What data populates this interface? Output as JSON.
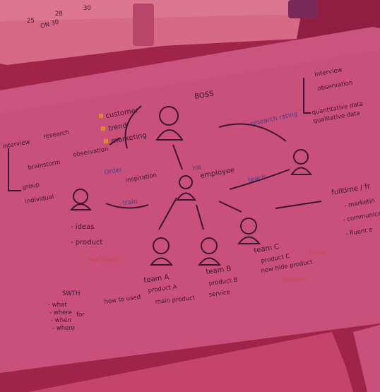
{
  "photo": {
    "tint": "#c43a64",
    "calendar_numbers": [
      "25",
      "28",
      "30"
    ],
    "calendar_note": "ON 30"
  },
  "sketch": {
    "boss": {
      "label": "BOSS",
      "checklist": [
        "customer",
        "trend",
        "marketing"
      ]
    },
    "research_flow": {
      "note": "research rating",
      "steps": [
        "interview",
        "observation",
        "quantitative data",
        "qualitative data"
      ]
    },
    "left_group": {
      "top": [
        "interview",
        "research"
      ],
      "mid": [
        "brainstorm",
        "observation"
      ],
      "bottom": [
        "group",
        "individual"
      ],
      "order": "Order",
      "inspiration": "inspiration",
      "train": "train",
      "ideas": [
        "- ideas",
        "- product"
      ],
      "trendy": "new trendy",
      "swot": "SWTH",
      "swot_items": [
        "- what",
        "- where",
        "- when",
        "- where"
      ],
      "for": "for",
      "how_to_use": "how to used"
    },
    "hr": {
      "label": "HR",
      "employee": "employee",
      "teach": "teach"
    },
    "right_text": {
      "fulltime": "fulltime / fr",
      "items": [
        "- marketin",
        "- communicat",
        "- fluent e"
      ]
    },
    "teams": [
      {
        "name": "team A",
        "items": [
          "team A",
          "product A",
          "main product"
        ]
      },
      {
        "name": "team B",
        "items": [
          "product B",
          "service"
        ]
      },
      {
        "name": "team C",
        "items": [
          "product C",
          "new hide product"
        ],
        "trend": "trend",
        "research": "research"
      }
    ]
  }
}
